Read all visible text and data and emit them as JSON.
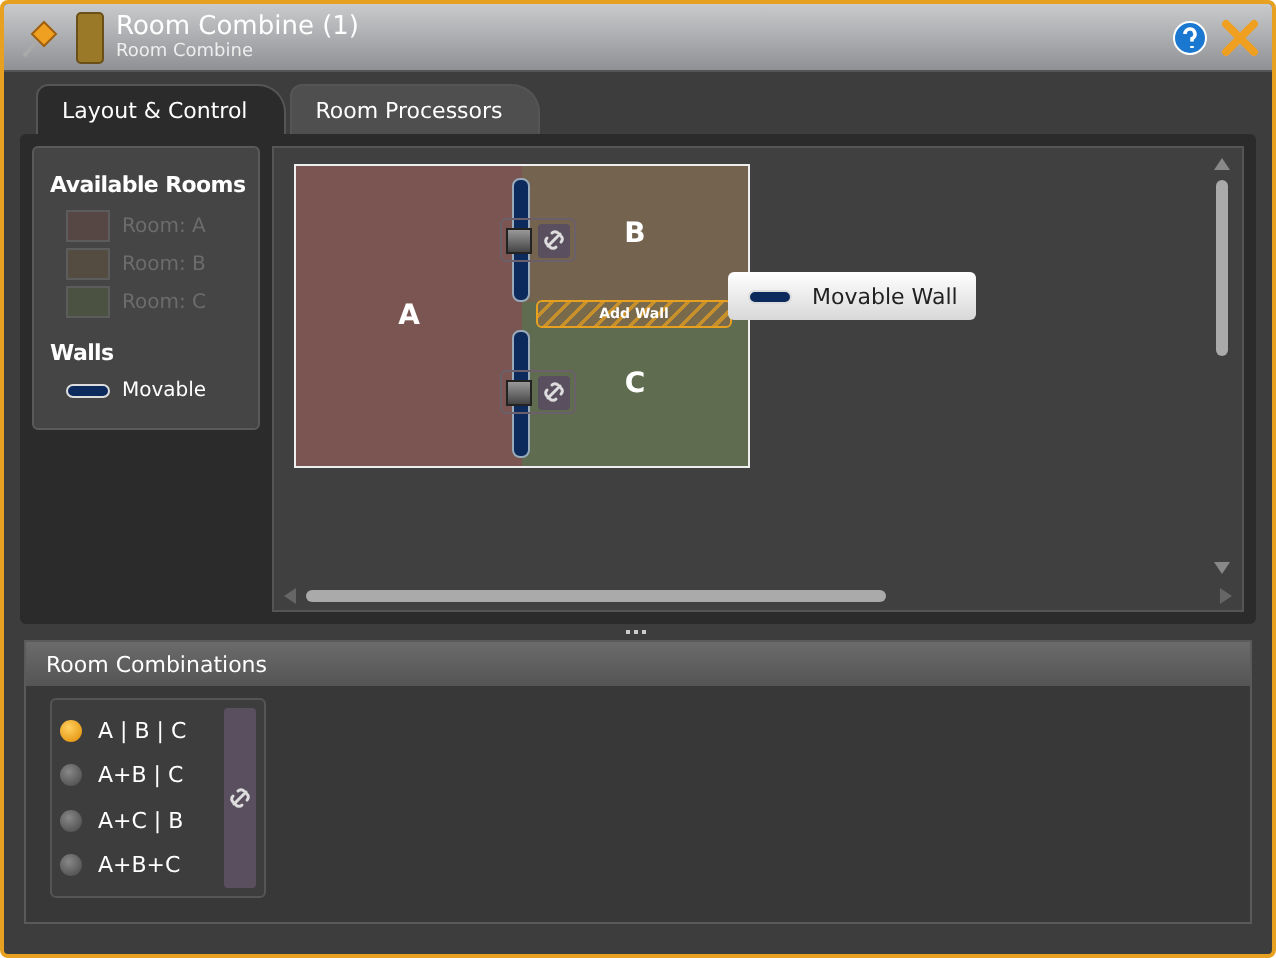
{
  "window": {
    "title": "Room Combine (1)",
    "subtitle": "Room Combine"
  },
  "tabs": [
    {
      "label": "Layout & Control",
      "selected": true
    },
    {
      "label": "Room Processors",
      "selected": false
    }
  ],
  "legend": {
    "rooms_heading": "Available Rooms",
    "rooms": [
      {
        "label": "Room: A",
        "color": "#574744"
      },
      {
        "label": "Room: B",
        "color": "#544c40"
      },
      {
        "label": "Room: C",
        "color": "#4b5241"
      }
    ],
    "walls_heading": "Walls",
    "walls": [
      {
        "label": "Movable"
      }
    ]
  },
  "layout": {
    "rooms": [
      {
        "label": "A",
        "color": "#7a5551"
      },
      {
        "label": "B",
        "color": "#74644f"
      },
      {
        "label": "C",
        "color": "#5f6c4f"
      }
    ],
    "add_wall": "Add Wall",
    "tooltip": "Movable Wall"
  },
  "combinations": {
    "title": "Room Combinations",
    "options": [
      {
        "label": "A | B | C",
        "selected": true
      },
      {
        "label": "A+B | C",
        "selected": false
      },
      {
        "label": "A+C | B",
        "selected": false
      },
      {
        "label": "A+B+C",
        "selected": false
      }
    ]
  }
}
